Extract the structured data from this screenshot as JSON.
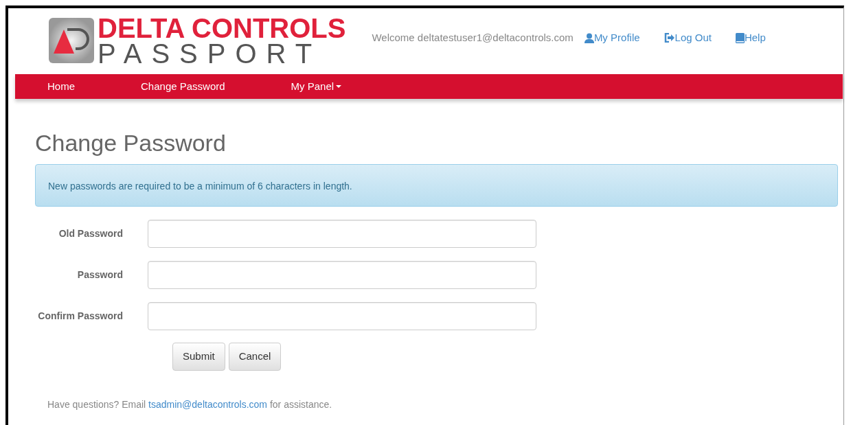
{
  "logo": {
    "line_1": "DELTA CONTROLS",
    "line_2": "PASSPORT"
  },
  "header": {
    "welcome": "Welcome deltatestuser1@deltacontrols.com",
    "links": [
      {
        "kind": "profile",
        "label": "My Profile"
      },
      {
        "kind": "logout",
        "label": "Log Out"
      },
      {
        "kind": "help",
        "label": "Help"
      }
    ]
  },
  "nav": [
    {
      "label": "Home",
      "dropdown": false
    },
    {
      "label": "Change Password",
      "dropdown": false
    },
    {
      "label": "My Panel",
      "dropdown": true
    }
  ],
  "page_title": "Change Password",
  "alert": "New passwords are required to be a minimum of 6 characters in length.",
  "fields": [
    {
      "label": "Old Password"
    },
    {
      "label": "Password"
    },
    {
      "label": "Confirm Password"
    }
  ],
  "buttons": [
    "Submit",
    "Cancel"
  ],
  "footer": {
    "before": "Have questions? Email",
    "link": "tsadmin@deltacontrols.com",
    "after": "for assistance."
  }
}
